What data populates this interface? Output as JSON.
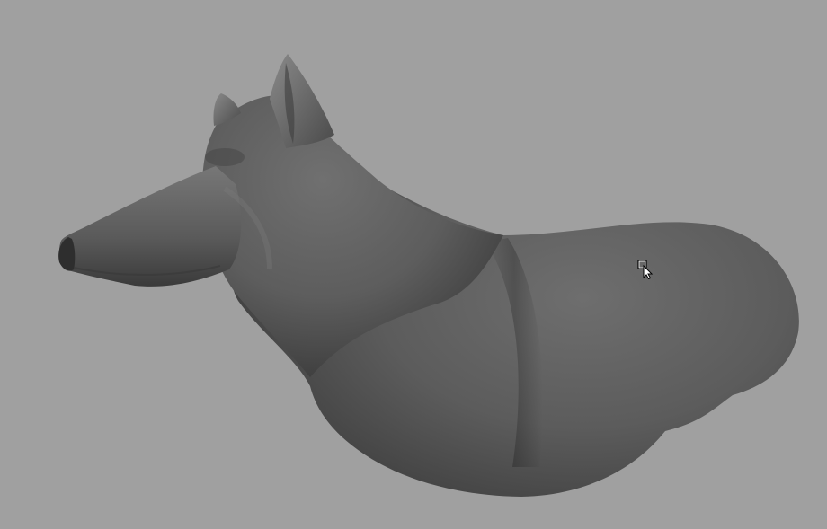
{
  "viewport": {
    "background_color": "#a0a0a0",
    "model_name": "wolf-sculpt",
    "model_base_color": "#5a5a5a",
    "model_highlight_color": "#7a7a7a",
    "model_shadow_color": "#333333",
    "cursor_icon": "select-marquee-cursor-icon"
  }
}
